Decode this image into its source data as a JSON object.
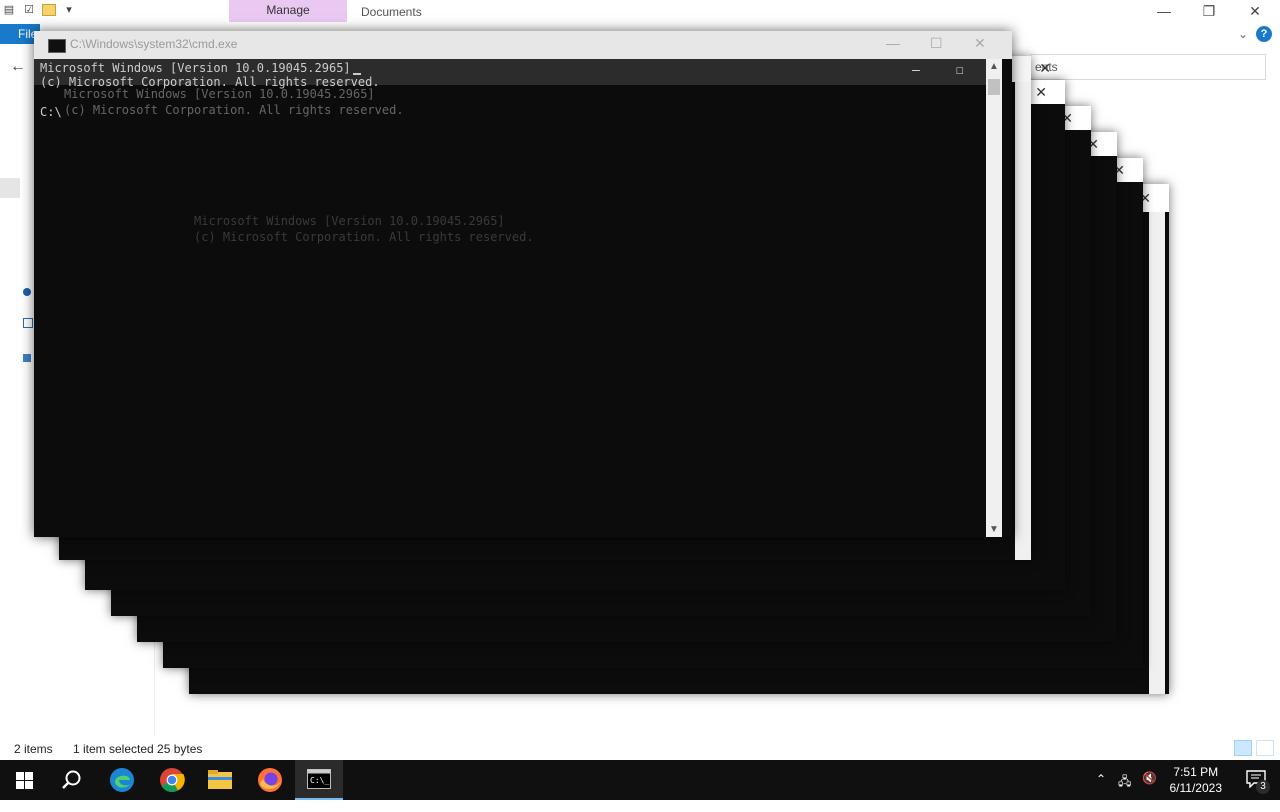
{
  "explorer": {
    "ribbon_context_tab": "Manage",
    "window_title": "Documents",
    "file_tab": "File",
    "search_placeholder": "Search Documents",
    "search_visible": "ents",
    "minimize": "—",
    "maximize": "❐",
    "close": "✕",
    "help": "?",
    "status": {
      "items": "2 items",
      "selected": "1 item selected  25 bytes"
    }
  },
  "cmd": {
    "title": "C:\\Windows\\system32\\cmd.exe",
    "line1": "Microsoft Windows [Version 10.0.19045.2965]",
    "line2": "(c) Microsoft Corporation. All rights reserved.",
    "prompt_fragment": "C:\\",
    "echo_line1": "Microsoft Windows [Version 10.0.19045.2965]",
    "echo_line2": "(c) Microsoft Corporation. All rights reserved.",
    "ghost_line1": "Microsoft Windows [Version 10.0.19045.2965]",
    "ghost_line2": "(c) Microsoft Corporation. All rights reserved.",
    "minimize": "—",
    "maximize": "☐",
    "close": "✕"
  },
  "taskbar": {
    "time": "7:51 PM",
    "date": "6/11/2023",
    "notification_count": "3",
    "icons": [
      "start-icon",
      "search-icon",
      "edge-icon",
      "chrome-icon",
      "file-explorer-icon",
      "firefox-icon",
      "cmd-icon"
    ],
    "colors": {
      "accent": "#76b9ed",
      "taskbar_bg": "#101010"
    }
  }
}
